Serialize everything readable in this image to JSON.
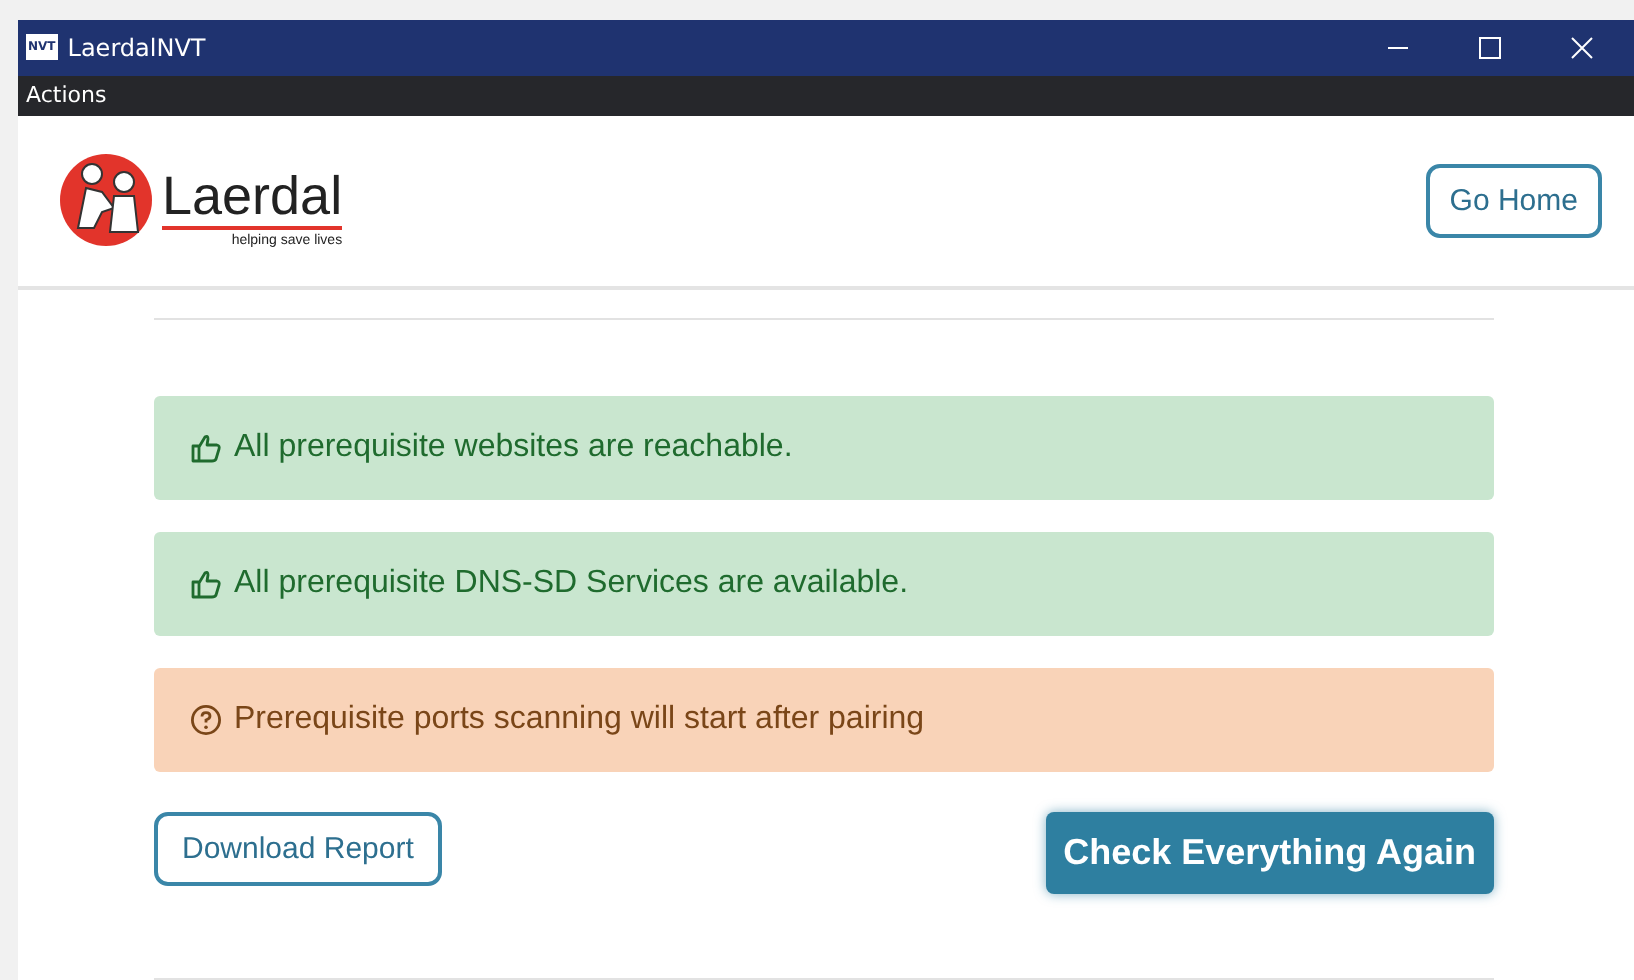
{
  "window": {
    "app_icon": "NVT",
    "title": "LaerdalNVT"
  },
  "menu": [
    "Actions"
  ],
  "logo": {
    "name": "Laerdal",
    "tagline": "helping save lives"
  },
  "header_button": "Go Home",
  "alerts": [
    {
      "kind": "success",
      "text": "All prerequisite websites are reachable."
    },
    {
      "kind": "success",
      "text": "All prerequisite DNS-SD Services are available."
    },
    {
      "kind": "pending",
      "text": "Prerequisite ports scanning will start after pairing"
    }
  ],
  "actions": {
    "secondary": "Download Report",
    "primary": "Check Everything Again"
  }
}
